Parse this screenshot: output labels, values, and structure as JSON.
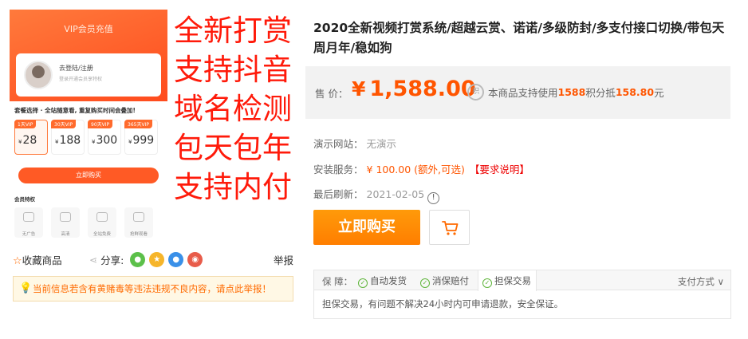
{
  "gallery": {
    "phone_title": "VIP会员充值",
    "user_name": "去登陆/注册",
    "user_sub": "登录开通会员享特权",
    "pkg_title": "套餐选择 · 全站随意看, 重复购买时间会叠加!",
    "packages": [
      {
        "tag": "1天VIP",
        "price": "28"
      },
      {
        "tag": "30天VIP",
        "price": "188"
      },
      {
        "tag": "90天VIP",
        "price": "300"
      },
      {
        "tag": "365天VIP",
        "price": "999"
      }
    ],
    "currency": "¥",
    "buy_label": "立即购买",
    "perk_title": "会员特权",
    "perks": [
      "无广告",
      "高清",
      "全站免费",
      "抢鲜观看"
    ],
    "promo_lines": [
      "全新打赏",
      "支持抖音",
      "域名检测",
      "包天包年",
      "支持内付"
    ]
  },
  "actions": {
    "favorite": "收藏商品",
    "share": "分享:",
    "report": "举报",
    "icons": [
      "wechat-icon",
      "qzone-icon",
      "qq-icon",
      "weibo-icon"
    ]
  },
  "notice": "当前信息若含有黄赌毒等违法违规不良内容，请点此举报！",
  "product": {
    "title": "2020全新视频打赏系统/超越云赏、诺诺/多级防封/多支付接口切换/带包天周月年/稳如狗",
    "price_label": "售 价：",
    "price_currency": "¥",
    "price": "1,588.00",
    "points_icon_text": "积",
    "points_pre": "本商品支持使用",
    "points_amount": "1588",
    "points_mid": "积分抵",
    "points_value": "158.80",
    "points_post": "元",
    "demo_label": "演示网站：",
    "demo_value": "无演示",
    "install_label": "安装服务：",
    "install_value": "¥ 100.00 (额外,可选)",
    "install_req": "【要求说明】",
    "refresh_label": "最后刷新：",
    "refresh_value": "2021-02-05",
    "buy_label": "立即购买"
  },
  "guarantee": {
    "label": "保    障：",
    "tabs": [
      "自动发货",
      "消保赔付",
      "担保交易"
    ],
    "active_tab": 2,
    "pay_methods": "支付方式",
    "body": "担保交易，有问题不解决24小时内可申请退款，安全保证。"
  },
  "colors": {
    "accent": "#ff5500",
    "buy_button": "#ff8a00",
    "promo_text": "#ff1a0a",
    "check_green": "#5fb53a"
  }
}
